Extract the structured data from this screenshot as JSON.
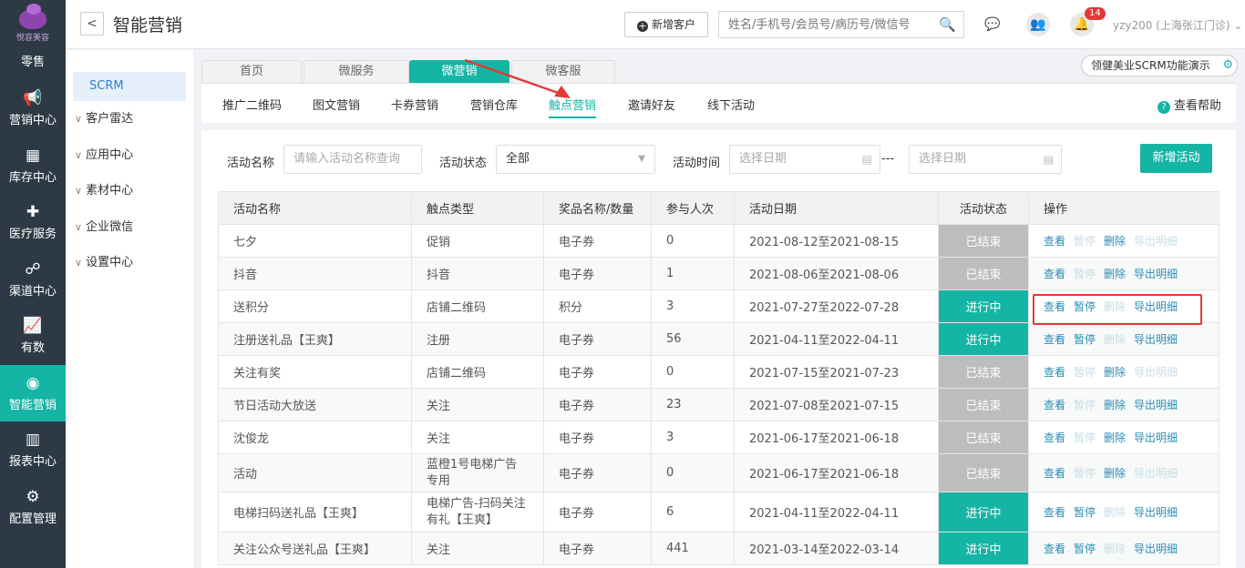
{
  "rail": {
    "brand": "悦容美容",
    "items": [
      {
        "label": "零售",
        "icon": "retail-icon"
      },
      {
        "label": "营销中心",
        "icon": "megaphone-icon"
      },
      {
        "label": "库存中心",
        "icon": "grid-icon"
      },
      {
        "label": "医疗服务",
        "icon": "medkit-icon"
      },
      {
        "label": "渠道中心",
        "icon": "hierarchy-icon"
      },
      {
        "label": "有数",
        "icon": "trend-icon"
      },
      {
        "label": "智能营销",
        "icon": "smart-icon"
      },
      {
        "label": "报表中心",
        "icon": "bar-chart-icon"
      },
      {
        "label": "配置管理",
        "icon": "gear-icon"
      }
    ],
    "active": "智能营销"
  },
  "header": {
    "back": "<",
    "title": "智能营销",
    "add_customer": "新增客户",
    "search_placeholder": "姓名/手机号/会员号/病历号/微信号",
    "notification_count": "14",
    "user": "yzy200 (上海张江门诊)"
  },
  "sidebar": {
    "scrm": "SCRM",
    "groups": [
      "客户雷达",
      "应用中心",
      "素材中心",
      "企业微信",
      "设置中心"
    ]
  },
  "tabs": [
    "首页",
    "微服务",
    "微营销",
    "微客服"
  ],
  "active_tab": "微营销",
  "subtabs": [
    "推广二维码",
    "图文营销",
    "卡券营销",
    "营销仓库",
    "触点营销",
    "邀请好友",
    "线下活动"
  ],
  "active_subtab": "触点营销",
  "help": "查看帮助",
  "demo": "领健美业SCRM功能演示",
  "filters": {
    "name_label": "活动名称",
    "name_placeholder": "请输入活动名称查询",
    "status_label": "活动状态",
    "status_value": "全部",
    "time_label": "活动时间",
    "date_placeholder": "选择日期",
    "sep": "---",
    "new_activity": "新增活动"
  },
  "table": {
    "columns": [
      "活动名称",
      "触点类型",
      "奖品名称/数量",
      "参与人次",
      "活动日期",
      "活动状态",
      "操作"
    ],
    "actions": [
      "查看",
      "暂停",
      "删除",
      "导出明细"
    ],
    "rows": [
      {
        "name": "七夕",
        "type": "促销",
        "prize": "电子券",
        "count": "0",
        "date": "2021-08-12至2021-08-15",
        "status": "已结束",
        "running": false,
        "enabled": [
          true,
          false,
          true,
          false
        ]
      },
      {
        "name": "抖音",
        "type": "抖音",
        "prize": "电子券",
        "count": "1",
        "date": "2021-08-06至2021-08-06",
        "status": "已结束",
        "running": false,
        "enabled": [
          true,
          false,
          true,
          true
        ]
      },
      {
        "name": "送积分",
        "type": "店铺二维码",
        "prize": "积分",
        "count": "3",
        "date": "2021-07-27至2022-07-28",
        "status": "进行中",
        "running": true,
        "enabled": [
          true,
          true,
          false,
          true
        ]
      },
      {
        "name": "注册送礼品【王爽】",
        "type": "注册",
        "prize": "电子券",
        "count": "56",
        "date": "2021-04-11至2022-04-11",
        "status": "进行中",
        "running": true,
        "enabled": [
          true,
          true,
          false,
          true
        ]
      },
      {
        "name": "关注有奖",
        "type": "店铺二维码",
        "prize": "电子券",
        "count": "0",
        "date": "2021-07-15至2021-07-23",
        "status": "已结束",
        "running": false,
        "enabled": [
          true,
          false,
          true,
          false
        ]
      },
      {
        "name": "节日活动大放送",
        "type": "关注",
        "prize": "电子券",
        "count": "23",
        "date": "2021-07-08至2021-07-15",
        "status": "已结束",
        "running": false,
        "enabled": [
          true,
          false,
          true,
          true
        ]
      },
      {
        "name": "沈俊龙",
        "type": "关注",
        "prize": "电子券",
        "count": "3",
        "date": "2021-06-17至2021-06-18",
        "status": "已结束",
        "running": false,
        "enabled": [
          true,
          false,
          true,
          true
        ]
      },
      {
        "name": "活动",
        "type": "蓝橙1号电梯广告专用",
        "prize": "电子券",
        "count": "0",
        "date": "2021-06-17至2021-06-18",
        "status": "已结束",
        "running": false,
        "enabled": [
          true,
          false,
          true,
          false
        ]
      },
      {
        "name": "电梯扫码送礼品【王爽】",
        "type": "电梯广告-扫码关注有礼【王爽】",
        "prize": "电子券",
        "count": "6",
        "date": "2021-04-11至2022-04-11",
        "status": "进行中",
        "running": true,
        "enabled": [
          true,
          true,
          false,
          true
        ]
      },
      {
        "name": "关注公众号送礼品【王爽】",
        "type": "关注",
        "prize": "电子券",
        "count": "441",
        "date": "2021-03-14至2022-03-14",
        "status": "进行中",
        "running": true,
        "enabled": [
          true,
          true,
          false,
          true
        ]
      }
    ]
  },
  "colors": {
    "accent": "#15b5a5",
    "rail": "#2d3a46",
    "ended": "#bdbdbd",
    "link": "#2a8cb5",
    "highlight": "#e53935"
  }
}
